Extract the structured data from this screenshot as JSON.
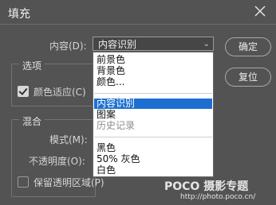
{
  "dialog": {
    "title": "填充",
    "content_label": "内容(D):",
    "content_value": "内容识别"
  },
  "buttons": {
    "ok": "确定",
    "reset": "复位"
  },
  "options": {
    "heading": "选项",
    "color_adapt": "颜色适应(C)",
    "color_adapt_checked": true
  },
  "blending": {
    "heading": "混合",
    "mode_label": "模式(M):",
    "opacity_label": "不透明度(O):",
    "preserve_transparency": "保留透明区域(P)"
  },
  "menu": {
    "group1": [
      "前景色",
      "背景色",
      "颜色..."
    ],
    "group2": [
      "内容识别",
      "图案",
      "历史记录"
    ],
    "group2_selected": "内容识别",
    "group2_disabled": "历史记录",
    "group3": [
      "黑色",
      "50% 灰色",
      "白色"
    ]
  },
  "watermark": {
    "brand": "POCO 摄影专题",
    "url": "http://photo.poco.cn/"
  }
}
